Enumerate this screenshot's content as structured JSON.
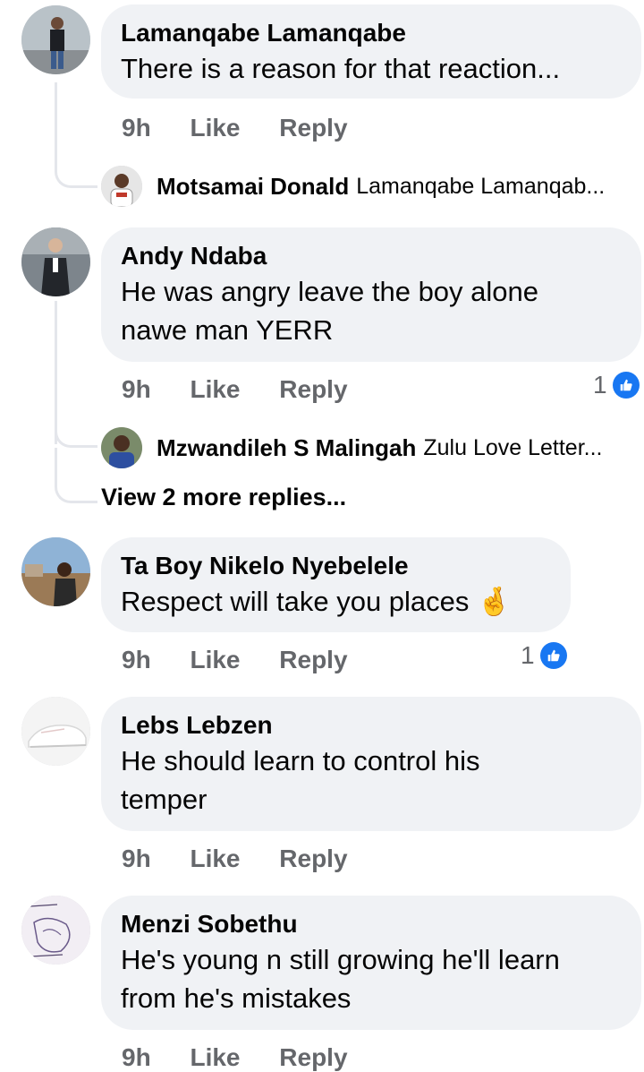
{
  "comments": [
    {
      "author": "Lamanqabe Lamanqabe",
      "lines": [
        "There is a reason  for  that reaction..."
      ],
      "time": "9h",
      "like": "Like",
      "reply": "Reply",
      "reply_preview": {
        "author": "Motsamai Donald",
        "snippet": "Lamanqabe Lamanqab..."
      }
    },
    {
      "author": "Andy Ndaba",
      "lines": [
        "He was angry leave the boy alone",
        "nawe man YERR"
      ],
      "time": "9h",
      "like": "Like",
      "reply": "Reply",
      "reaction_count": "1",
      "reply_preview": {
        "author": "Mzwandileh S Malingah",
        "snippet": "Zulu Love Letter..."
      },
      "view_more": "View 2 more replies..."
    },
    {
      "author": "Ta Boy Nikelo Nyebelele",
      "lines": [
        "Respect will take you places 🤞"
      ],
      "time": "9h",
      "like": "Like",
      "reply": "Reply",
      "reaction_count": "1"
    },
    {
      "author": "Lebs Lebzen",
      "lines": [
        "He should learn to control his",
        "temper"
      ],
      "time": "9h",
      "like": "Like",
      "reply": "Reply"
    },
    {
      "author": "Menzi Sobethu",
      "lines": [
        "He's young n still growing he'll learn",
        "from he's mistakes"
      ],
      "time": "9h",
      "like": "Like",
      "reply": "Reply"
    }
  ],
  "colors": {
    "bubble": "#f0f2f5",
    "meta": "#65676b",
    "like_badge": "#1877f2",
    "thread_line": "#e4e6eb"
  },
  "icons": {
    "reaction": "thumbs-up-icon"
  }
}
